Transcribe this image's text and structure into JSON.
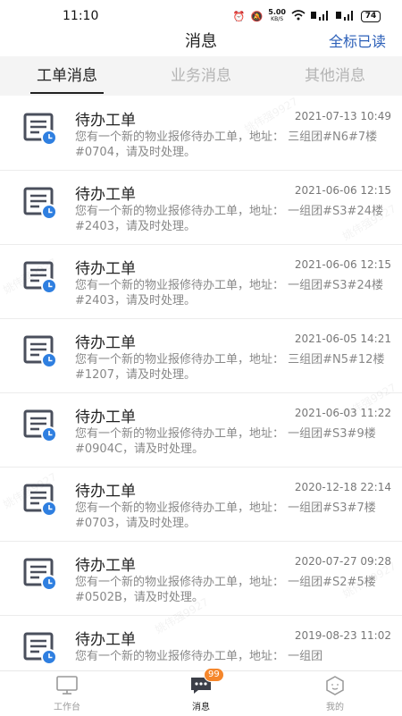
{
  "status_bar": {
    "time": "11:10",
    "net_speed_top": "5.00",
    "net_speed_bottom": "KB/S",
    "battery": "74"
  },
  "header": {
    "title": "消息",
    "mark_all_read": "全标已读"
  },
  "tabs": [
    {
      "label": "工单消息",
      "active": true
    },
    {
      "label": "业务消息",
      "active": false
    },
    {
      "label": "其他消息",
      "active": false
    }
  ],
  "messages": [
    {
      "title": "待办工单",
      "time": "2021-07-13 10:49",
      "body": "您有一个新的物业报修待办工单，地址： 三组团#N6#7楼#0704，请及时处理。"
    },
    {
      "title": "待办工单",
      "time": "2021-06-06 12:15",
      "body": "您有一个新的物业报修待办工单，地址： 一组团#S3#24楼#2403，请及时处理。"
    },
    {
      "title": "待办工单",
      "time": "2021-06-06 12:15",
      "body": "您有一个新的物业报修待办工单，地址： 一组团#S3#24楼#2403，请及时处理。"
    },
    {
      "title": "待办工单",
      "time": "2021-06-05 14:21",
      "body": "您有一个新的物业报修待办工单，地址： 三组团#N5#12楼#1207，请及时处理。"
    },
    {
      "title": "待办工单",
      "time": "2021-06-03 11:22",
      "body": "您有一个新的物业报修待办工单，地址： 一组团#S3#9楼#0904C，请及时处理。"
    },
    {
      "title": "待办工单",
      "time": "2020-12-18 22:14",
      "body": "您有一个新的物业报修待办工单，地址： 一组团#S3#7楼#0703，请及时处理。"
    },
    {
      "title": "待办工单",
      "time": "2020-07-27 09:28",
      "body": "您有一个新的物业报修待办工单，地址： 一组团#S2#5楼#0502B，请及时处理。"
    },
    {
      "title": "待办工单",
      "time": "2019-08-23 11:02",
      "body": "您有一个新的物业报修待办工单，地址： 一组团"
    }
  ],
  "watermark_text": "姚伟强9927",
  "bottom_nav": [
    {
      "label": "工作台",
      "icon": "monitor-icon",
      "active": false
    },
    {
      "label": "消息",
      "icon": "chat-icon",
      "active": true,
      "badge": "99"
    },
    {
      "label": "我的",
      "icon": "profile-icon",
      "active": false
    }
  ],
  "colors": {
    "accent": "#2b5fb8",
    "badge": "#f5862b",
    "doc_icon": "#4a4f5c",
    "clock_icon": "#2f7fe0"
  }
}
